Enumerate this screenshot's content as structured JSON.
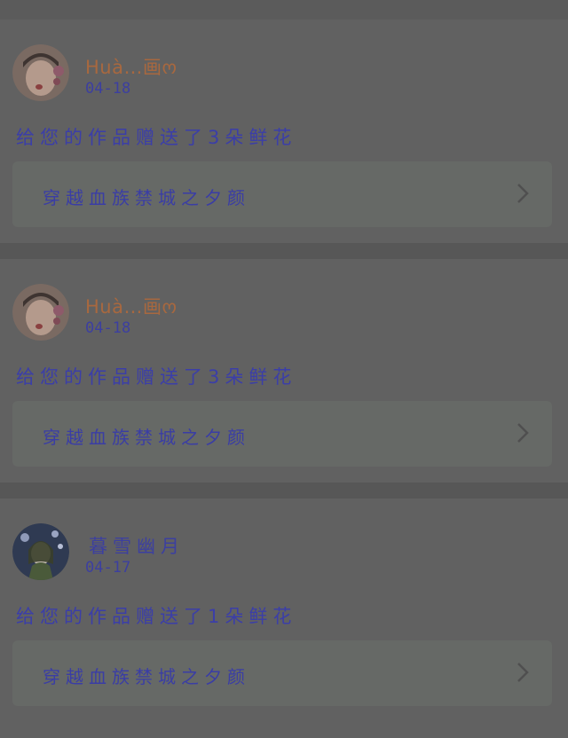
{
  "items": [
    {
      "user": {
        "name": "Huà…画ო",
        "name_color": "#a8683f"
      },
      "date": "04-18",
      "message": "给您的作品赠送了3朵鲜花",
      "work": {
        "title": "穿越血族禁城之夕颜"
      },
      "icons": {
        "avatar": "avatar-girl-icon",
        "chevron": "chevron-right-icon"
      }
    },
    {
      "user": {
        "name": "Huà…画ო",
        "name_color": "#a8683f"
      },
      "date": "04-18",
      "message": "给您的作品赠送了3朵鲜花",
      "work": {
        "title": "穿越血族禁城之夕颜"
      },
      "icons": {
        "avatar": "avatar-girl-icon",
        "chevron": "chevron-right-icon"
      }
    },
    {
      "user": {
        "name": "暮雪幽月",
        "name_color": "#3c3fa0"
      },
      "date": "04-17",
      "message": "给您的作品赠送了1朵鲜花",
      "work": {
        "title": "穿越血族禁城之夕颜"
      },
      "icons": {
        "avatar": "avatar-anime-icon",
        "chevron": "chevron-right-icon"
      }
    }
  ],
  "colors": {
    "background": "#595959",
    "card": "#616161",
    "link_box": "#666966",
    "text_purple": "#3c3fa0"
  }
}
